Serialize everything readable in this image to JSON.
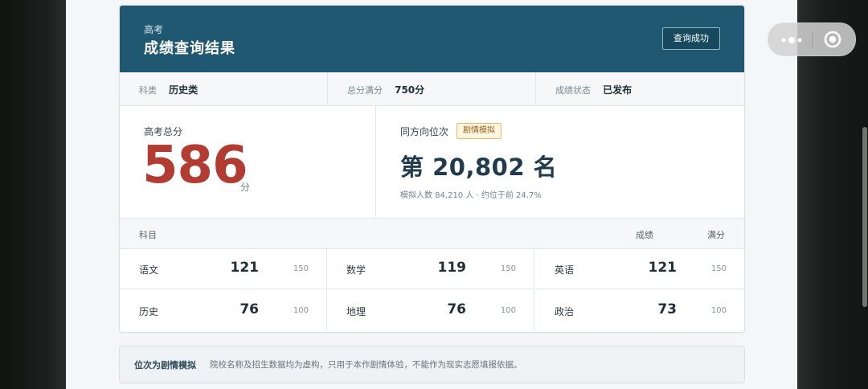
{
  "header": {
    "kicker": "高考",
    "title": "成绩查询结果",
    "status_button": "查询成功"
  },
  "meta": [
    {
      "label": "科类",
      "value": "历史类"
    },
    {
      "label": "总分满分",
      "value": "750分"
    },
    {
      "label": "成绩状态",
      "value": "已发布"
    }
  ],
  "score": {
    "label": "高考总分",
    "value": "586",
    "unit": "分"
  },
  "rank": {
    "label": "同方向位次",
    "badge": "剧情模拟",
    "value": "第 20,802 名",
    "note": "模拟人数 84,210 人 · 约位于前 24.7%"
  },
  "subjects": {
    "headers": {
      "subject": "科目",
      "score": "成绩",
      "full": "满分"
    },
    "rows": [
      {
        "name": "语文",
        "score": "121",
        "full": "150"
      },
      {
        "name": "数学",
        "score": "119",
        "full": "150"
      },
      {
        "name": "英语",
        "score": "121",
        "full": "150"
      },
      {
        "name": "历史",
        "score": "76",
        "full": "100"
      },
      {
        "name": "地理",
        "score": "76",
        "full": "100"
      },
      {
        "name": "政治",
        "score": "73",
        "full": "100"
      }
    ]
  },
  "note": {
    "title": "位次为剧情模拟",
    "text": "院校名称及招生数据均为虚构，只用于本作剧情体验，不能作为现实志愿填报依据。"
  },
  "colors": {
    "header_bg": "#1f5870",
    "score_red": "#b23b32",
    "rank_blue": "#1f3b4d",
    "badge_border": "#e6b86d"
  },
  "icons": {
    "more": "more-dots-icon",
    "close": "target-close-icon"
  }
}
